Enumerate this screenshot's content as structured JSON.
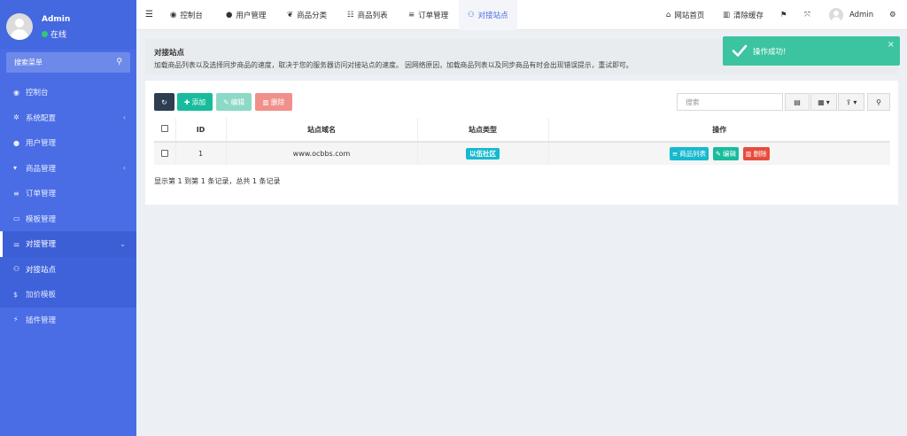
{
  "sidebar": {
    "user_name": "Admin",
    "user_status": "在线",
    "search_label": "搜索菜单",
    "items": [
      {
        "label": "控制台",
        "icon": "dashboard-icon"
      },
      {
        "label": "系统配置",
        "icon": "gear-icon"
      },
      {
        "label": "用户管理",
        "icon": "user-icon"
      },
      {
        "label": "商品管理",
        "icon": "cart-icon"
      },
      {
        "label": "订单管理",
        "icon": "list-icon"
      },
      {
        "label": "模板管理",
        "icon": "template-icon"
      },
      {
        "label": "对接管理",
        "icon": "sliders-icon"
      }
    ],
    "sub_items": [
      {
        "label": "对接站点",
        "icon": "sitemap-icon"
      },
      {
        "label": "加价模板",
        "icon": "dollar-icon"
      }
    ],
    "after_items": [
      {
        "label": "插件管理",
        "icon": "plug-icon"
      }
    ]
  },
  "navbar": {
    "tabs": [
      {
        "label": "控制台",
        "icon": "dashboard-icon"
      },
      {
        "label": "用户管理",
        "icon": "user-icon"
      },
      {
        "label": "商品分类",
        "icon": "leaf-icon"
      },
      {
        "label": "商品列表",
        "icon": "list-icon"
      },
      {
        "label": "订单管理",
        "icon": "list-icon"
      },
      {
        "label": "对接站点",
        "icon": "sitemap-icon"
      }
    ],
    "right": {
      "home_label": "网站首页",
      "clear_cache_label": "清除缓存",
      "user_name": "Admin"
    }
  },
  "info": {
    "title": "对接站点",
    "description": "加载商品列表以及选择同步商品的速度，取决于您的服务器访问对接站点的速度。 因网络原因，加载商品列表以及同步商品有时会出现错误提示，重试即可。"
  },
  "toast": {
    "message": "操作成功!",
    "close": "×"
  },
  "toolbar": {
    "add_label": "添加",
    "edit_label": "编辑",
    "delete_label": "删除",
    "search_placeholder": "搜索"
  },
  "table": {
    "headers": [
      "ID",
      "站点域名",
      "站点类型",
      "操作"
    ],
    "rows": [
      {
        "id": "1",
        "domain": "www.ocbbs.com",
        "type": "以伍社区"
      }
    ],
    "row_actions": {
      "list_label": "商品列表",
      "edit_label": "编辑",
      "delete_label": "删除"
    },
    "pager_info": "显示第 1 到第 1 条记录，总共 1 条记录"
  },
  "colors": {
    "sidebar": "#4a6de5",
    "success": "#18bc9c",
    "info": "#17b9cf",
    "danger": "#e74c3c",
    "dark": "#2c3e50"
  }
}
